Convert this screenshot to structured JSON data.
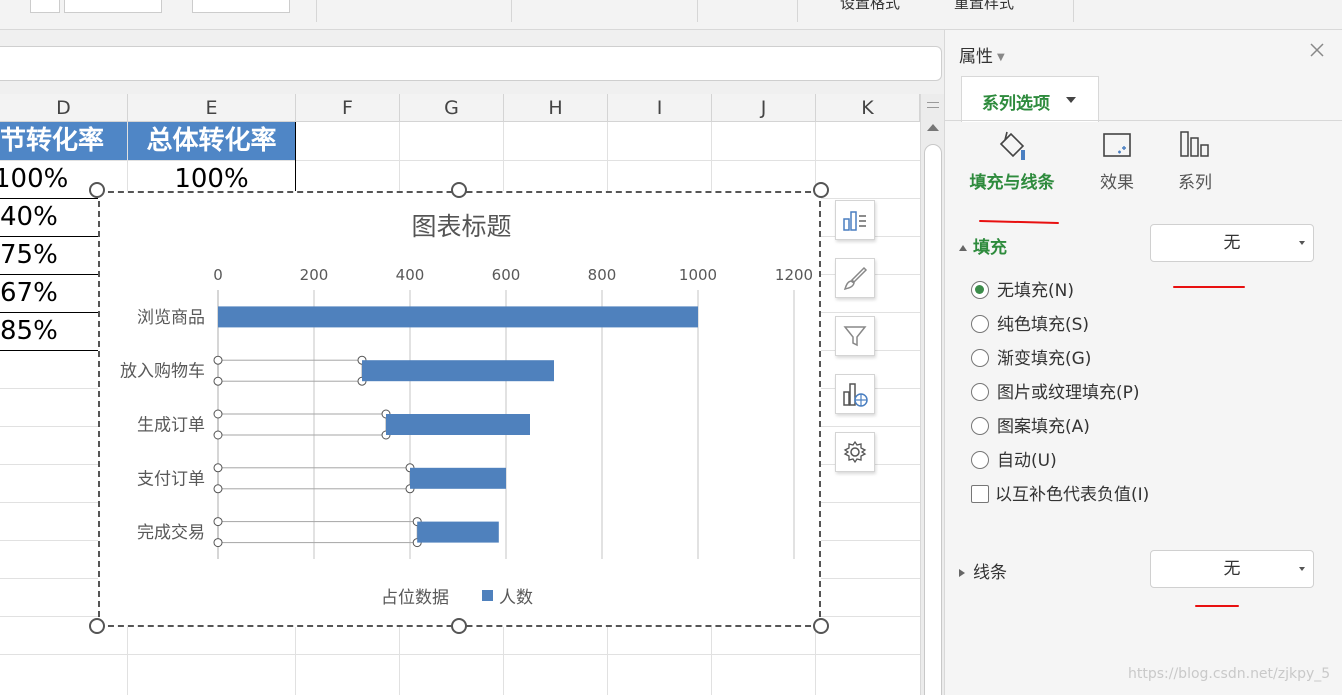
{
  "ribbon": {
    "partial_labels": [
      "设置格式",
      "重置样式"
    ]
  },
  "sheet": {
    "columns": [
      "D",
      "E",
      "F",
      "G",
      "H",
      "I",
      "J",
      "K"
    ],
    "headers": {
      "D": "节转化率",
      "E": "总体转化率"
    },
    "col_d_values": [
      "100%",
      "40%",
      "75%",
      "67%",
      "85%"
    ],
    "col_e_values": [
      "100%"
    ]
  },
  "chart": {
    "title": "图表标题",
    "legend": [
      "占位数据",
      "人数"
    ]
  },
  "chart_data": {
    "type": "bar",
    "orientation": "horizontal",
    "stacked": true,
    "categories": [
      "浏览商品",
      "放入购物车",
      "生成订单",
      "支付订单",
      "完成交易"
    ],
    "series": [
      {
        "name": "占位数据",
        "values": [
          0,
          300,
          350,
          400,
          415
        ],
        "fill": "none"
      },
      {
        "name": "人数",
        "values": [
          1000,
          400,
          300,
          200,
          170
        ],
        "color": "#4f81bd"
      }
    ],
    "x_ticks": [
      "0",
      "200",
      "400",
      "600",
      "800",
      "1000",
      "1200"
    ],
    "xlim": [
      0,
      1200
    ],
    "x_axis_position": "top",
    "grid": true,
    "legend_position": "bottom"
  },
  "tools": [
    "chart-elements-icon",
    "chart-style-icon",
    "chart-filter-icon",
    "chart-layout-icon",
    "settings-gear-icon"
  ],
  "panel": {
    "title": "属性",
    "tab": "系列选项",
    "subtabs": [
      "填充与线条",
      "效果",
      "系列"
    ],
    "fill_section": "填充",
    "fill_value": "无",
    "fill_options": [
      "无填充(N)",
      "纯色填充(S)",
      "渐变填充(G)",
      "图片或纹理填充(P)",
      "图案填充(A)",
      "自动(U)"
    ],
    "invert_label": "以互补色代表负值(I)",
    "line_section": "线条",
    "line_value": "无"
  },
  "watermark": "https://blog.csdn.net/zjkpy_5",
  "colors": {
    "accent_green": "#2e8b3d",
    "bar_blue": "#4f81bd",
    "header_blue": "#4f86c6",
    "annotation_red": "#e81010"
  }
}
